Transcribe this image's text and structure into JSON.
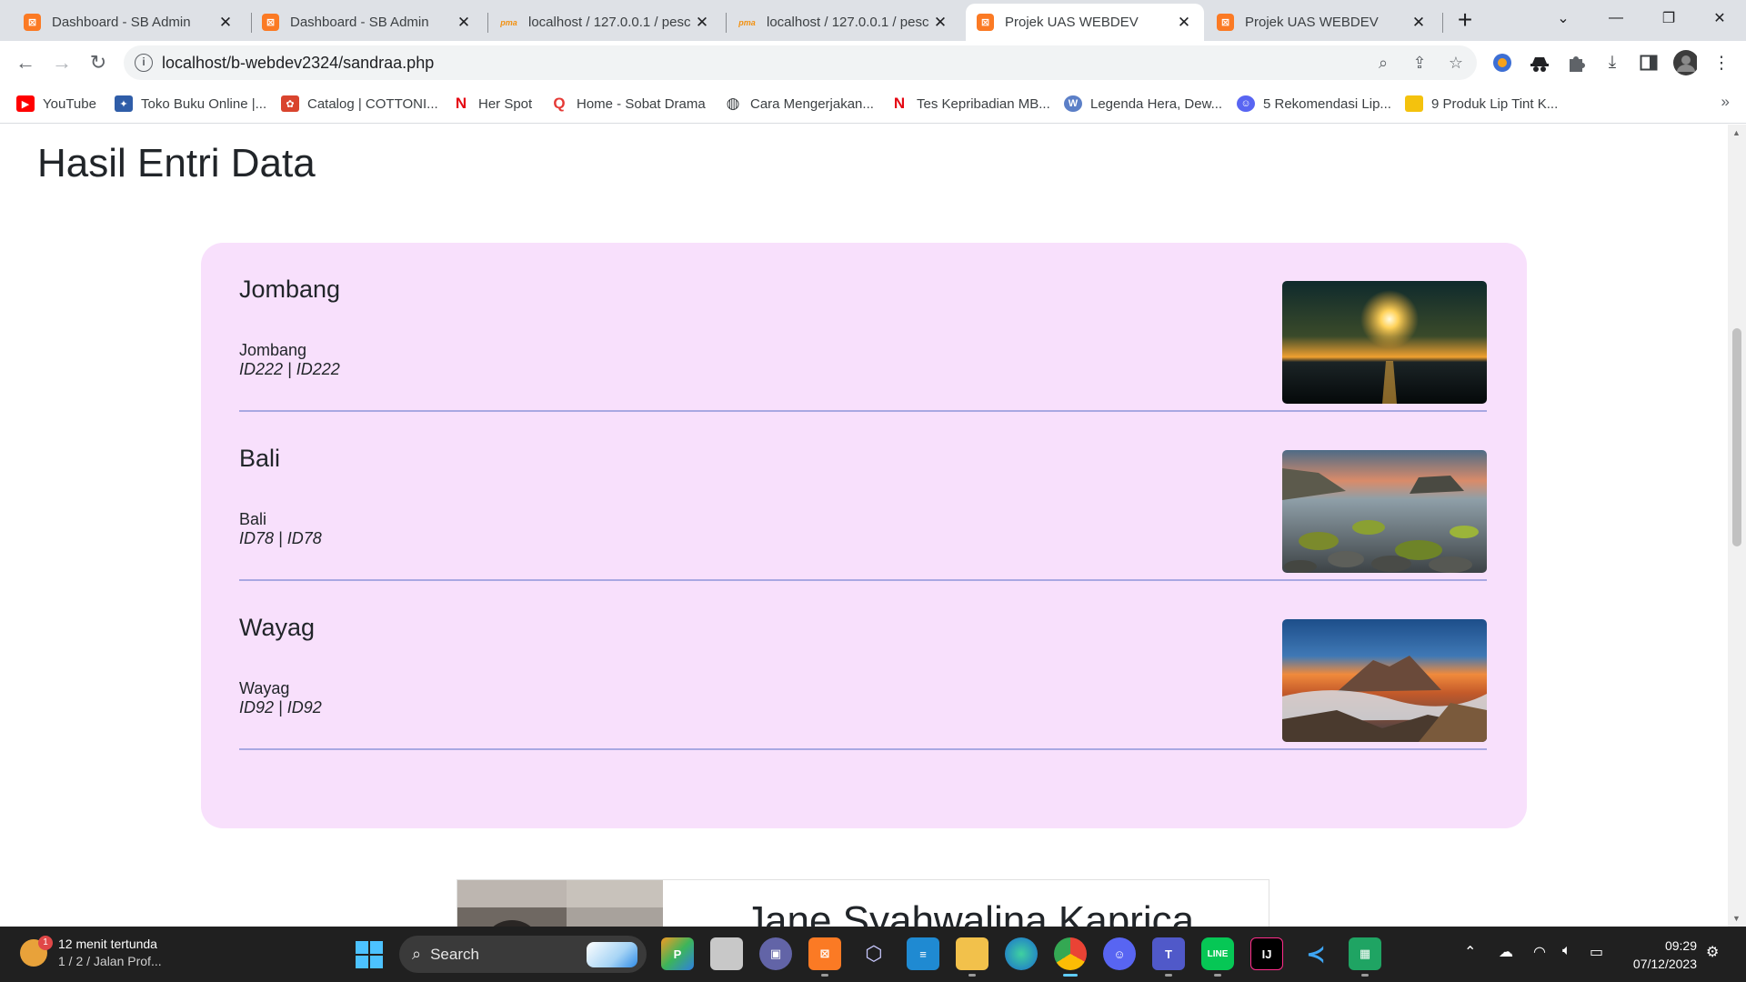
{
  "browser": {
    "tabs": [
      {
        "title": "Dashboard - SB Admin",
        "icon": "xampp-icon"
      },
      {
        "title": "Dashboard - SB Admin",
        "icon": "xampp-icon"
      },
      {
        "title": "localhost / 127.0.0.1 / pesc",
        "icon": "phpmyadmin-icon"
      },
      {
        "title": "localhost / 127.0.0.1 / pesc",
        "icon": "phpmyadmin-icon"
      },
      {
        "title": "Projek UAS WEBDEV",
        "icon": "xampp-icon",
        "active": true
      },
      {
        "title": "Projek UAS WEBDEV",
        "icon": "xampp-icon"
      }
    ],
    "url": "localhost/b-webdev2324/sandraa.php",
    "bookmarks": [
      {
        "label": "YouTube",
        "icon": "youtube-icon",
        "color": "#ff0000"
      },
      {
        "label": "Toko Buku Online |...",
        "icon": "bookstore-icon",
        "color": "#2f5da8"
      },
      {
        "label": "Catalog | COTTONI...",
        "icon": "cottonink-icon",
        "color": "#d9442e"
      },
      {
        "label": "Her Spot",
        "icon": "netflix-icon",
        "color": "#e50914"
      },
      {
        "label": "Home - Sobat Drama",
        "icon": "sobatdrama-icon",
        "color": "#e53935"
      },
      {
        "label": "Cara Mengerjakan...",
        "icon": "globe-icon",
        "color": "#3c4043"
      },
      {
        "label": "Tes Kepribadian MB...",
        "icon": "netflix-icon",
        "color": "#e50914"
      },
      {
        "label": "Legenda Hera, Dew...",
        "icon": "wordpress-icon",
        "color": "#5b7fc7"
      },
      {
        "label": "5 Rekomendasi Lip...",
        "icon": "discord-icon",
        "color": "#5865f2"
      },
      {
        "label": "9 Produk Lip Tint K...",
        "icon": "folder-icon",
        "color": "#f4c20d"
      }
    ]
  },
  "page": {
    "title": "Hasil Entri Data",
    "entries": [
      {
        "name": "Jombang",
        "subtitle": "Jombang",
        "ids": "ID222 | ID222",
        "image": "sunset-sea-photo"
      },
      {
        "name": "Bali",
        "subtitle": "Bali",
        "ids": "ID78 | ID78",
        "image": "mossy-rocks-beach-photo"
      },
      {
        "name": "Wayag",
        "subtitle": "Wayag",
        "ids": "ID92 | ID92",
        "image": "volcano-sunrise-photo"
      }
    ],
    "profile_name": "Jane Syahwalina Kaprica"
  },
  "taskbar": {
    "weather_badge": "1",
    "weather_line1": "12 menit tertunda",
    "weather_line2": "1 / 2 / Jalan Prof...",
    "search_label": "Search",
    "time": "09:29",
    "date": "07/12/2023"
  },
  "colors": {
    "card_bg": "#f8e0fc",
    "divider": "#a9a8e2",
    "tabstrip": "#dee1e6",
    "taskbar": "#202020"
  }
}
